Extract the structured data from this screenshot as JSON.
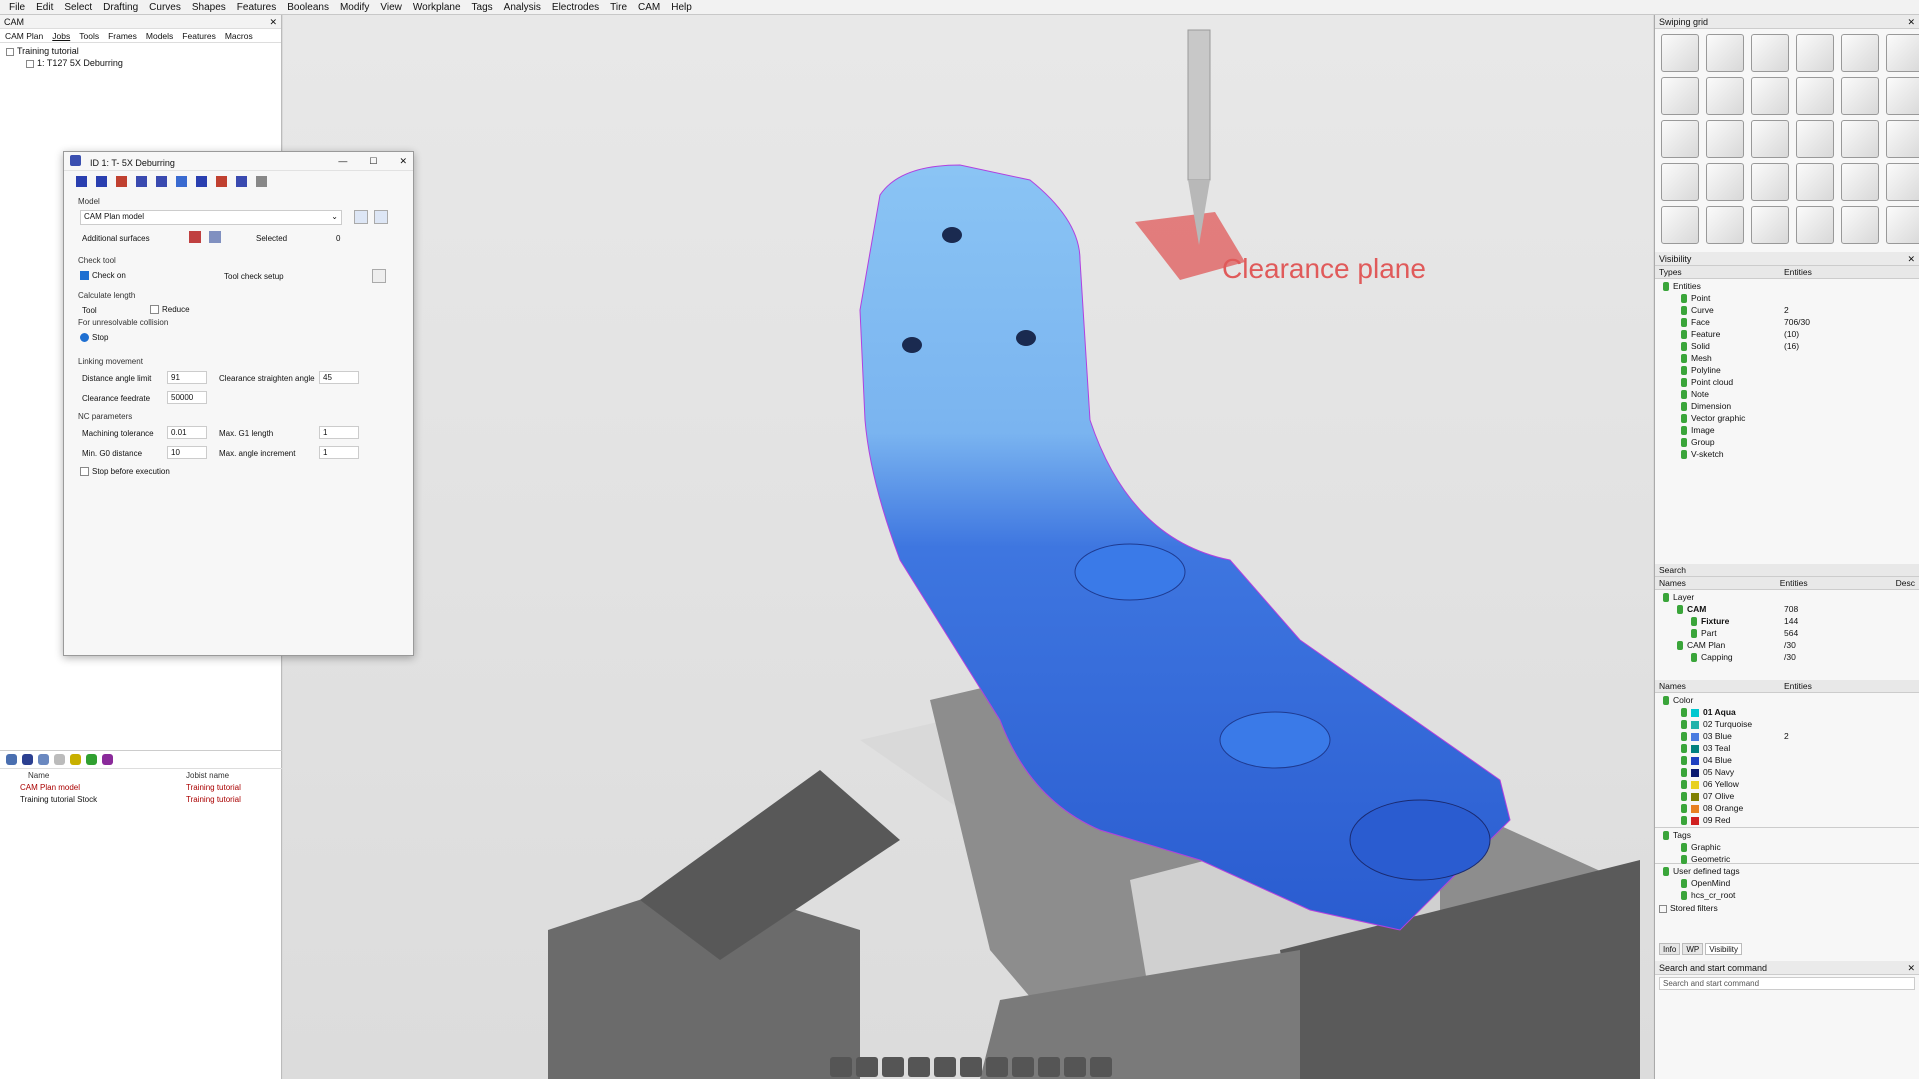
{
  "menubar": [
    "File",
    "Edit",
    "Select",
    "Drafting",
    "Curves",
    "Shapes",
    "Features",
    "Booleans",
    "Modify",
    "View",
    "Workplane",
    "Tags",
    "Analysis",
    "Electrodes",
    "Tire",
    "CAM",
    "Help"
  ],
  "left": {
    "title": "CAM",
    "tabs": [
      "CAM Plan",
      "Jobs",
      "Tools",
      "Frames",
      "Models",
      "Features",
      "Macros"
    ],
    "tree": [
      "Training tutorial",
      "1: T127 5X Deburring"
    ],
    "bottom_headers": {
      "name": "Name",
      "joblist": "Jobist name"
    },
    "bottom_rows": [
      {
        "name": "CAM Plan model",
        "joblist": "Training tutorial"
      },
      {
        "name": "Training tutorial Stock",
        "joblist": "Training tutorial"
      }
    ]
  },
  "dialog": {
    "title": "ID 1: T- 5X Deburring",
    "model_label": "Model",
    "model_value": "CAM Plan model",
    "add_surfaces": "Additional surfaces",
    "selected_label": "Selected",
    "selected_value": "0",
    "check_tool": "Check tool",
    "check_on": "Check on",
    "tool_check_setup": "Tool check setup",
    "calc_length": "Calculate length",
    "tool": "Tool",
    "reduce": "Reduce",
    "unresolvable": "For unresolvable collision",
    "stop": "Stop",
    "linking": "Linking movement",
    "dist_angle_limit": "Distance angle limit",
    "dist_angle_value": "91",
    "clear_straighten": "Clearance straighten angle",
    "clear_straighten_value": "45",
    "clear_feed": "Clearance feedrate",
    "clear_feed_value": "50000",
    "nc_params": "NC parameters",
    "mach_tol": "Machining tolerance",
    "mach_tol_value": "0.01",
    "max_g1": "Max. G1 length",
    "max_g1_value": "1",
    "min_g0": "Min. G0 distance",
    "min_g0_value": "10",
    "max_angle": "Max. angle increment",
    "max_angle_value": "1",
    "stop_before": "Stop before execution"
  },
  "viewport": {
    "clearance_label": "Clearance plane"
  },
  "right": {
    "swiping_title": "Swiping grid",
    "visibility_title": "Visibility",
    "types_header": "Types",
    "entities_header": "Entities",
    "entities": [
      {
        "name": "Entities",
        "val": ""
      },
      {
        "name": "Point",
        "val": ""
      },
      {
        "name": "Curve",
        "val": "2"
      },
      {
        "name": "Face",
        "val": "706/30"
      },
      {
        "name": "Feature",
        "val": "(10)"
      },
      {
        "name": "Solid",
        "val": "(16)"
      },
      {
        "name": "Mesh",
        "val": ""
      },
      {
        "name": "Polyline",
        "val": ""
      },
      {
        "name": "Point cloud",
        "val": ""
      },
      {
        "name": "Note",
        "val": ""
      },
      {
        "name": "Dimension",
        "val": ""
      },
      {
        "name": "Vector graphic",
        "val": ""
      },
      {
        "name": "Image",
        "val": ""
      },
      {
        "name": "Group",
        "val": ""
      },
      {
        "name": "V-sketch",
        "val": ""
      }
    ],
    "search_label": "Search",
    "names_header": "Names",
    "desc_header": "Desc",
    "layers": [
      {
        "name": "Layer",
        "val": ""
      },
      {
        "name": "CAM",
        "val": "708"
      },
      {
        "name": "Fixture",
        "val": "144"
      },
      {
        "name": "Part",
        "val": "564"
      },
      {
        "name": "CAM Plan",
        "val": "/30"
      },
      {
        "name": "Capping",
        "val": "/30"
      }
    ],
    "colors": [
      {
        "name": "Color",
        "val": "",
        "c": ""
      },
      {
        "name": "01 Aqua",
        "val": "",
        "c": "#00c8d0"
      },
      {
        "name": "02 Turquoise",
        "val": "",
        "c": "#20b2aa"
      },
      {
        "name": "03 Blue",
        "val": "2",
        "c": "#4a7be0"
      },
      {
        "name": "03 Teal",
        "val": "",
        "c": "#008080"
      },
      {
        "name": "04 Blue",
        "val": "",
        "c": "#1e40c0"
      },
      {
        "name": "05 Navy",
        "val": "",
        "c": "#0a1a70"
      },
      {
        "name": "06 Yellow",
        "val": "",
        "c": "#e8d020"
      },
      {
        "name": "07 Olive",
        "val": "",
        "c": "#808000"
      },
      {
        "name": "08 Orange",
        "val": "",
        "c": "#e88020"
      },
      {
        "name": "09 Red",
        "val": "",
        "c": "#d02020"
      }
    ],
    "tags": [
      "Tags",
      "Graphic",
      "Geometric"
    ],
    "user_tags": [
      "User defined tags",
      "OpenMind",
      "hcs_cr_root"
    ],
    "stored_filters": "Stored filters",
    "bottom_tabs": [
      "Info",
      "WP",
      "Visibility"
    ],
    "cmd_title": "Search and start command",
    "cmd_placeholder": "Search and start command"
  }
}
